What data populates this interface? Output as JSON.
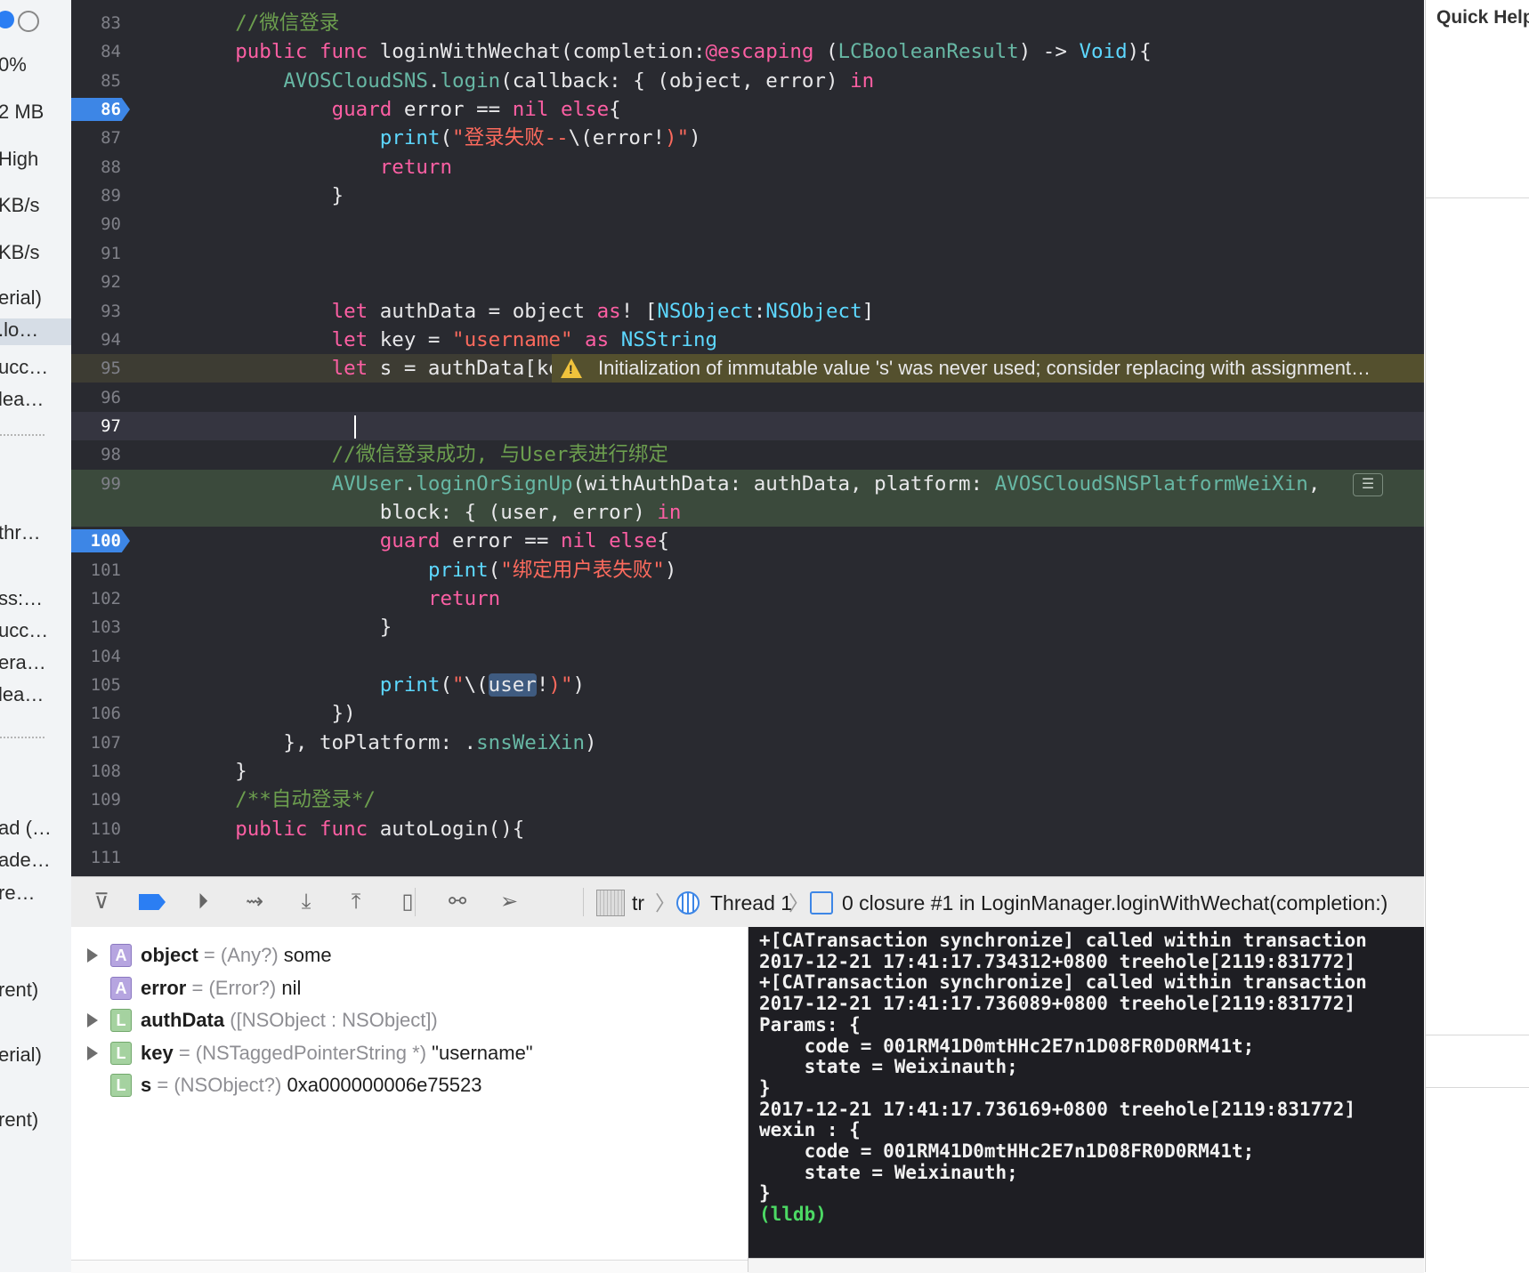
{
  "navigator": {
    "rows": [
      {
        "text": "0%"
      },
      {
        "text": "2 MB"
      },
      {
        "text": "High"
      },
      {
        "text": "KB/s"
      },
      {
        "text": "KB/s"
      },
      {
        "text": "erial)"
      },
      {
        "text": ".lo…"
      },
      {
        "text": "ucc…"
      },
      {
        "text": "lea…"
      },
      {
        "text": "thr…"
      },
      {
        "text": "ss:…"
      },
      {
        "text": "ucc…"
      },
      {
        "text": "era…"
      },
      {
        "text": "lea…"
      },
      {
        "text": "ad (…"
      },
      {
        "text": "ade…"
      },
      {
        "text": "re…"
      },
      {
        "text": "rent)"
      },
      {
        "text": "erial)"
      },
      {
        "text": "rent)"
      }
    ]
  },
  "editor": {
    "lines": [
      {
        "num": "83",
        "seg": [
          [
            "    ",
            "plain"
          ],
          [
            "//微信登录",
            "cmt"
          ]
        ]
      },
      {
        "num": "84",
        "seg": [
          [
            "    ",
            "plain"
          ],
          [
            "public",
            "kw"
          ],
          [
            " ",
            "plain"
          ],
          [
            "func",
            "kw"
          ],
          [
            " loginWithWechat(completion:",
            "plain"
          ],
          [
            "@escaping",
            "kw"
          ],
          [
            " (",
            "plain"
          ],
          [
            "LCBooleanResult",
            "fn"
          ],
          [
            ") -> ",
            "plain"
          ],
          [
            "Void",
            "typ"
          ],
          [
            "){",
            "plain"
          ]
        ]
      },
      {
        "num": "85",
        "seg": [
          [
            "        ",
            "plain"
          ],
          [
            "AVOSCloudSNS",
            "fn"
          ],
          [
            ".",
            "plain"
          ],
          [
            "login",
            "fn"
          ],
          [
            "(callback: { (object, error) ",
            "plain"
          ],
          [
            "in",
            "kw"
          ]
        ]
      },
      {
        "num": "86",
        "bp": true,
        "seg": [
          [
            "            ",
            "plain"
          ],
          [
            "guard",
            "kw"
          ],
          [
            " error == ",
            "plain"
          ],
          [
            "nil",
            "kw"
          ],
          [
            " ",
            "plain"
          ],
          [
            "else",
            "kw"
          ],
          [
            "{",
            "plain"
          ]
        ]
      },
      {
        "num": "87",
        "seg": [
          [
            "                ",
            "plain"
          ],
          [
            "print",
            "typ"
          ],
          [
            "(",
            "plain"
          ],
          [
            "\"登录失败--",
            "str"
          ],
          [
            "\\(",
            "plain"
          ],
          [
            "error!",
            "plain"
          ],
          [
            ")\"",
            "str"
          ],
          [
            ")",
            "plain"
          ]
        ]
      },
      {
        "num": "88",
        "seg": [
          [
            "                ",
            "plain"
          ],
          [
            "return",
            "kw"
          ]
        ]
      },
      {
        "num": "89",
        "seg": [
          [
            "            }",
            "plain"
          ]
        ]
      },
      {
        "num": "90",
        "seg": []
      },
      {
        "num": "91",
        "seg": []
      },
      {
        "num": "92",
        "seg": []
      },
      {
        "num": "93",
        "seg": [
          [
            "            ",
            "plain"
          ],
          [
            "let",
            "kw"
          ],
          [
            " authData = object ",
            "plain"
          ],
          [
            "as",
            "kw"
          ],
          [
            "! [",
            "plain"
          ],
          [
            "NSObject",
            "typ"
          ],
          [
            ":",
            "plain"
          ],
          [
            "NSObject",
            "typ"
          ],
          [
            "]",
            "plain"
          ]
        ]
      },
      {
        "num": "94",
        "seg": [
          [
            "            ",
            "plain"
          ],
          [
            "let",
            "kw"
          ],
          [
            " key = ",
            "plain"
          ],
          [
            "\"username\"",
            "str"
          ],
          [
            " ",
            "plain"
          ],
          [
            "as",
            "kw"
          ],
          [
            " ",
            "plain"
          ],
          [
            "NSString",
            "typ"
          ]
        ]
      },
      {
        "num": "95",
        "hl": "warn",
        "seg": [
          [
            "            ",
            "plain"
          ],
          [
            "let",
            "kw"
          ],
          [
            " s = authData[key]",
            "plain"
          ]
        ],
        "warning": "Initialization of immutable value 's' was never used; consider replacing with assignment…"
      },
      {
        "num": "96",
        "seg": []
      },
      {
        "num": "97",
        "hl": "cur",
        "bold": true,
        "seg": []
      },
      {
        "num": "98",
        "seg": [
          [
            "            ",
            "plain"
          ],
          [
            "//微信登录成功, 与User表进行绑定",
            "cmt"
          ]
        ]
      },
      {
        "num": "99",
        "hl": "exec",
        "seg": [
          [
            "            ",
            "plain"
          ],
          [
            "AVUser",
            "fn"
          ],
          [
            ".",
            "plain"
          ],
          [
            "loginOrSignUp",
            "fn"
          ],
          [
            "(withAuthData: authData, platform: ",
            "plain"
          ],
          [
            "AVOSCloudSNSPlatformWeiXin",
            "fn"
          ],
          [
            ",",
            "plain"
          ]
        ]
      },
      {
        "num": "",
        "hl": "exec",
        "seg": [
          [
            "                block: { (user, error) ",
            "plain"
          ],
          [
            "in",
            "kw"
          ]
        ]
      },
      {
        "num": "100",
        "bp": true,
        "seg": [
          [
            "                ",
            "plain"
          ],
          [
            "guard",
            "kw"
          ],
          [
            " error == ",
            "plain"
          ],
          [
            "nil",
            "kw"
          ],
          [
            " ",
            "plain"
          ],
          [
            "else",
            "kw"
          ],
          [
            "{",
            "plain"
          ]
        ]
      },
      {
        "num": "101",
        "seg": [
          [
            "                    ",
            "plain"
          ],
          [
            "print",
            "typ"
          ],
          [
            "(",
            "plain"
          ],
          [
            "\"绑定用户表失败\"",
            "str"
          ],
          [
            ")",
            "plain"
          ]
        ]
      },
      {
        "num": "102",
        "seg": [
          [
            "                    ",
            "plain"
          ],
          [
            "return",
            "kw"
          ]
        ]
      },
      {
        "num": "103",
        "seg": [
          [
            "                }",
            "plain"
          ]
        ]
      },
      {
        "num": "104",
        "seg": []
      },
      {
        "num": "105",
        "seg": [
          [
            "                ",
            "plain"
          ],
          [
            "print",
            "typ"
          ],
          [
            "(",
            "plain"
          ],
          [
            "\"",
            "str"
          ],
          [
            "\\(",
            "plain"
          ],
          [
            "user",
            "sel"
          ],
          [
            "!",
            "plain"
          ],
          [
            ")\"",
            "str"
          ],
          [
            ")",
            "plain"
          ]
        ]
      },
      {
        "num": "106",
        "seg": [
          [
            "            })",
            "plain"
          ]
        ]
      },
      {
        "num": "107",
        "seg": [
          [
            "        }, toPlatform: .",
            "plain"
          ],
          [
            "snsWeiXin",
            "fn"
          ],
          [
            ")",
            "plain"
          ]
        ]
      },
      {
        "num": "108",
        "seg": [
          [
            "    }",
            "plain"
          ]
        ]
      },
      {
        "num": "109",
        "seg": [
          [
            "    ",
            "plain"
          ],
          [
            "/**自动登录*/",
            "cmt"
          ]
        ]
      },
      {
        "num": "110",
        "seg": [
          [
            "    ",
            "plain"
          ],
          [
            "public",
            "kw"
          ],
          [
            " ",
            "plain"
          ],
          [
            "func",
            "kw"
          ],
          [
            " autoLogin(){",
            "plain"
          ]
        ]
      },
      {
        "num": "111",
        "seg": []
      }
    ]
  },
  "inspector": {
    "title": "Quick Help"
  },
  "debug_bar": {
    "buttons": [
      {
        "name": "hide-debug-area-button",
        "glyph": "⊽"
      },
      {
        "name": "breakpoints-toggle-button",
        "glyph": ""
      },
      {
        "name": "continue-button",
        "glyph": "⏵"
      },
      {
        "name": "step-over-button",
        "glyph": "⇝"
      },
      {
        "name": "step-into-button",
        "glyph": "⤓"
      },
      {
        "name": "step-out-button",
        "glyph": "⤒"
      },
      {
        "name": "view-hierarchy-button",
        "glyph": "▯"
      },
      {
        "name": "memory-graph-button",
        "glyph": "⚯"
      },
      {
        "name": "simulate-location-button",
        "glyph": "➢"
      }
    ],
    "crumb_process": "tr",
    "crumb_thread": "Thread 1",
    "crumb_frame": "0 closure #1 in LoginManager.loginWithWechat(completion:)"
  },
  "variables": [
    {
      "expand": true,
      "kind": "A",
      "name": "object",
      "eq": " = ",
      "type": "(Any?)",
      "value": " some"
    },
    {
      "expand": false,
      "kind": "A",
      "name": "error",
      "eq": " = ",
      "type": "(Error?)",
      "value": " nil"
    },
    {
      "expand": true,
      "kind": "L",
      "name": "authData",
      "eq": " ",
      "type": "([NSObject : NSObject])",
      "value": ""
    },
    {
      "expand": true,
      "kind": "L",
      "name": "key",
      "eq": " = ",
      "type": "(NSTaggedPointerString *)",
      "value": " \"username\""
    },
    {
      "expand": false,
      "kind": "L",
      "name": "s",
      "eq": " = ",
      "type": "(NSObject?)",
      "value": " 0xa000000006e75523"
    }
  ],
  "console": {
    "lines": [
      "+[CATransaction synchronize] called within transaction",
      "2017-12-21 17:41:17.734312+0800 treehole[2119:831772]",
      "+[CATransaction synchronize] called within transaction",
      "2017-12-21 17:41:17.736089+0800 treehole[2119:831772]",
      "Params: {",
      "    code = 001RM41D0mtHHc2E7n1D08FR0D0RM41t;",
      "    state = Weixinauth;",
      "}",
      "2017-12-21 17:41:17.736169+0800 treehole[2119:831772]",
      "wexin : {",
      "    code = 001RM41D0mtHHc2E7n1D08FR0D0RM41t;",
      "    state = Weixinauth;",
      "}"
    ],
    "prompt": "(lldb)"
  },
  "colors": {
    "editor_bg": "#292a30",
    "keyword": "#fc5fa3",
    "string": "#fc6a5d",
    "comment": "#6c9e4e",
    "type": "#5dd8ff",
    "function": "#67b7a4",
    "breakpoint": "#3d86e6"
  }
}
